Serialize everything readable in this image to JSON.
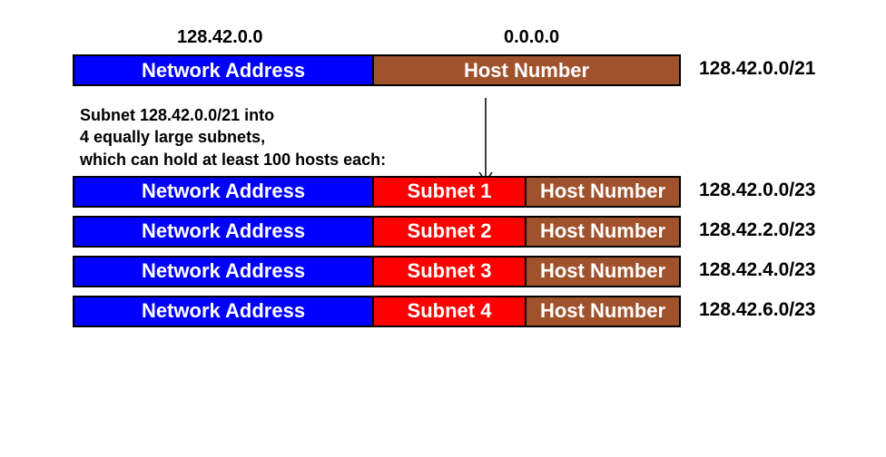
{
  "top": {
    "header_left": "128.42.0.0",
    "header_right": "0.0.0.0",
    "network_label": "Network Address",
    "host_label": "Host Number",
    "cidr": "128.42.0.0/21"
  },
  "instructions": {
    "line1": "Subnet 128.42.0.0/21 into",
    "line2": "4 equally large subnets,",
    "line3": "which can hold at least 100 hosts each:"
  },
  "subnets": [
    {
      "network_label": "Network Address",
      "subnet_label": "Subnet 1",
      "host_label": "Host Number",
      "cidr": "128.42.0.0/23"
    },
    {
      "network_label": "Network Address",
      "subnet_label": "Subnet 2",
      "host_label": "Host Number",
      "cidr": "128.42.2.0/23"
    },
    {
      "network_label": "Network Address",
      "subnet_label": "Subnet 3",
      "host_label": "Host Number",
      "cidr": "128.42.4.0/23"
    },
    {
      "network_label": "Network Address",
      "subnet_label": "Subnet 4",
      "host_label": "Host Number",
      "cidr": "128.42.6.0/23"
    }
  ]
}
